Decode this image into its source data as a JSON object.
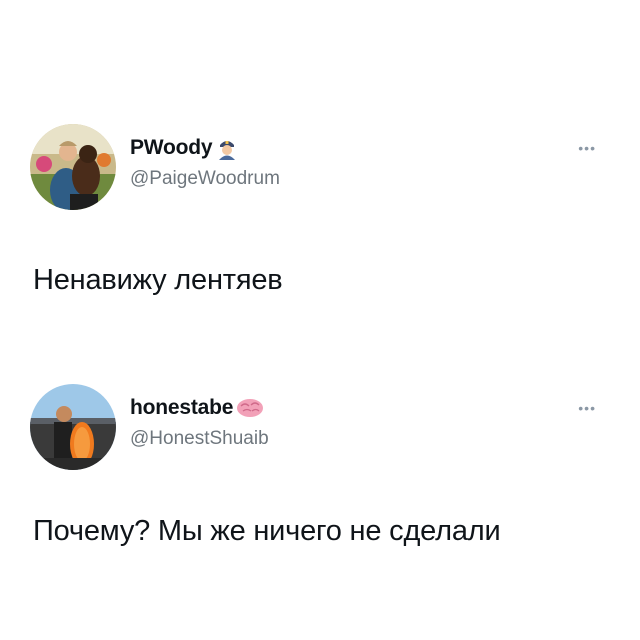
{
  "tweets": [
    {
      "display_name": "PWoody",
      "name_emoji": "police-officer-emoji",
      "handle": "@PaigeWoodrum",
      "text": "Ненавижу лентяев",
      "more_label": "•••"
    },
    {
      "display_name": "honestabe",
      "name_emoji": "brain-emoji",
      "handle": "@HonestShuaib",
      "text": "Почему? Мы же ничего не сделали",
      "more_label": "•••"
    }
  ],
  "colors": {
    "background": "#ffffff",
    "text": "#0f1419",
    "secondary": "#6e767d",
    "more_icon": "#8b98a5"
  }
}
